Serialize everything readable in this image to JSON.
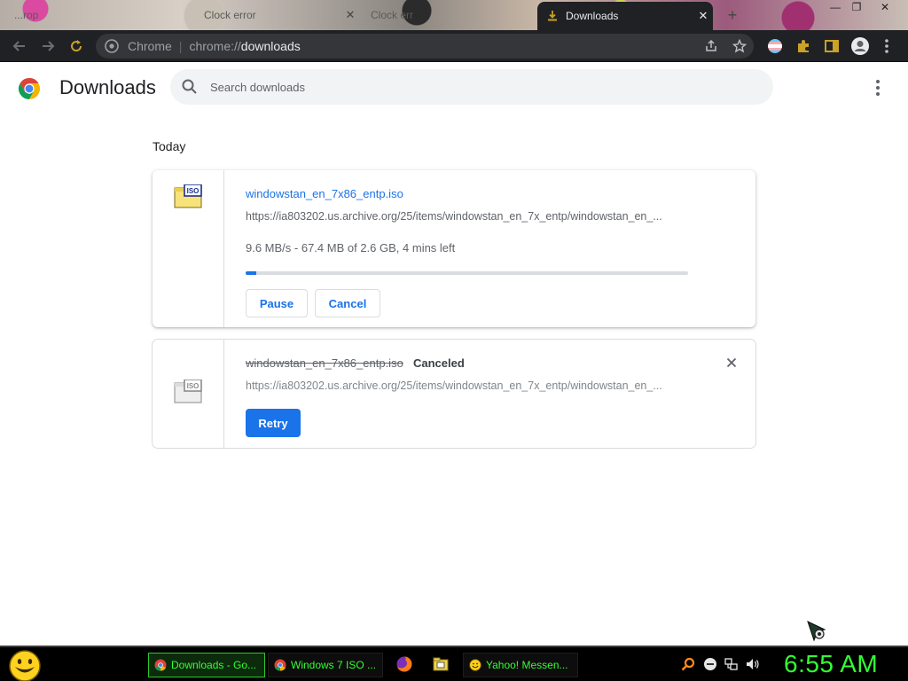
{
  "browser": {
    "tabs": [
      {
        "title": "...rop"
      },
      {
        "title": "Clock error"
      },
      {
        "title": "Clock err"
      },
      {
        "title": "Downloads",
        "active": true
      }
    ],
    "omnibox": {
      "scheme_label": "Chrome",
      "url_prefix": "chrome://",
      "url_host": "downloads"
    }
  },
  "downloads_page": {
    "title": "Downloads",
    "search_placeholder": "Search downloads",
    "section_label": "Today",
    "items": [
      {
        "file_name": "windowstan_en_7x86_entp.iso",
        "url": "https://ia803202.us.archive.org/25/items/windowstan_en_7x_entp/windowstan_en_...",
        "progress_text": "9.6 MB/s - 67.4 MB of 2.6 GB, 4 mins left",
        "progress_fraction": 0.025,
        "buttons": {
          "pause": "Pause",
          "cancel": "Cancel"
        },
        "icon_label": "ISO"
      },
      {
        "file_name": "windowstan_en_7x86_entp.iso",
        "status": "Canceled",
        "url": "https://ia803202.us.archive.org/25/items/windowstan_en_7x_entp/windowstan_en_...",
        "buttons": {
          "retry": "Retry"
        },
        "icon_label": "ISO"
      }
    ]
  },
  "taskbar": {
    "tasks": [
      {
        "label": "Downloads - Go...",
        "icon": "chrome-icon",
        "active": true
      },
      {
        "label": "Windows 7 ISO ...",
        "icon": "chrome-icon"
      },
      {
        "label": "Yahoo! Messen...",
        "icon": "smiley-icon"
      }
    ],
    "clock": "6:55 AM"
  },
  "colors": {
    "accent": "#1a73e8",
    "toolbar": "#202124",
    "taskbar_text": "#33ff33"
  }
}
